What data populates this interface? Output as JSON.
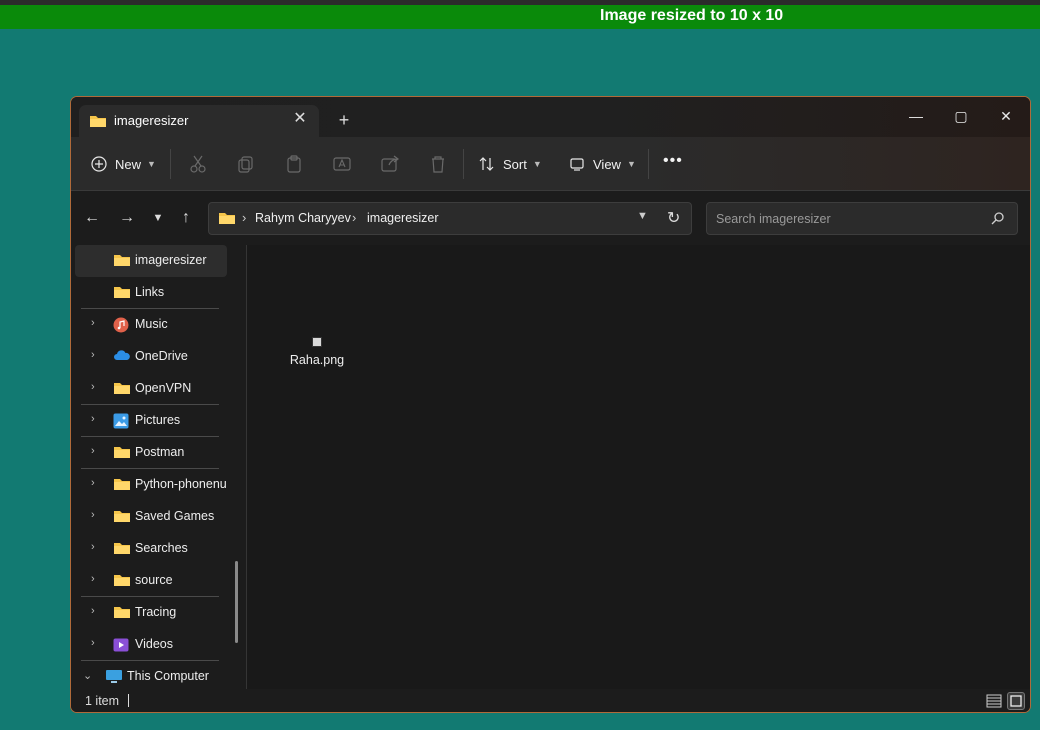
{
  "banner": {
    "text": "Image resized to 10 x 10"
  },
  "window": {
    "tab_title": "imageresizer",
    "controls": {
      "minimize": "—",
      "maximize": "▢",
      "close": "✕"
    }
  },
  "toolbar": {
    "new_label": "New",
    "sort_label": "Sort",
    "view_label": "View",
    "more_label": "•••"
  },
  "address": {
    "crumbs": [
      "Rahym Charyyev",
      "imageresizer"
    ]
  },
  "search": {
    "placeholder": "Search imageresizer"
  },
  "sidebar": {
    "items": [
      {
        "label": "imageresizer",
        "icon": "folder-icon"
      },
      {
        "label": "Links",
        "icon": "folder-icon"
      },
      {
        "label": "Music",
        "icon": "music-icon"
      },
      {
        "label": "OneDrive",
        "icon": "cloud-icon"
      },
      {
        "label": "OpenVPN",
        "icon": "folder-icon"
      },
      {
        "label": "Pictures",
        "icon": "pictures-icon"
      },
      {
        "label": "Postman",
        "icon": "folder-icon"
      },
      {
        "label": "Python-phonenu",
        "icon": "folder-icon"
      },
      {
        "label": "Saved Games",
        "icon": "folder-icon"
      },
      {
        "label": "Searches",
        "icon": "folder-icon"
      },
      {
        "label": "source",
        "icon": "folder-icon"
      },
      {
        "label": "Tracing",
        "icon": "folder-icon"
      },
      {
        "label": "Videos",
        "icon": "videos-icon"
      },
      {
        "label": "This Computer",
        "icon": "computer-icon"
      }
    ]
  },
  "files": [
    {
      "name": "Raha.png"
    }
  ],
  "status": {
    "count": "1 item"
  },
  "colors": {
    "accent_border": "#b06a3a",
    "banner": "#0a8a0a",
    "desktop": "#127a72",
    "folder": "#f5c54a"
  }
}
